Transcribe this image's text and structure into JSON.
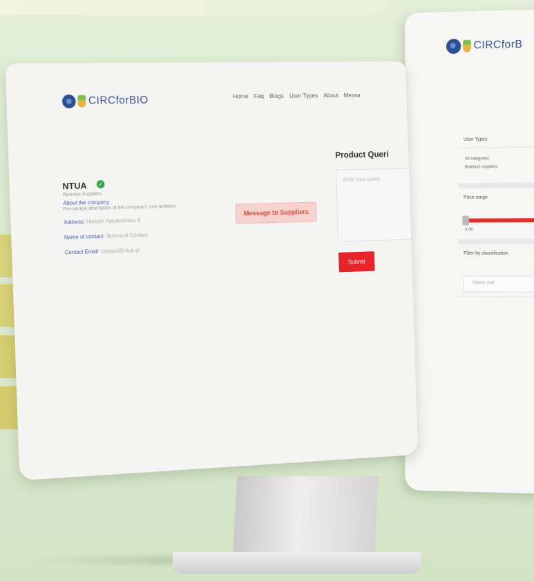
{
  "monitor1": {
    "logo_text": "CIRCforBIO",
    "nav": [
      "Home",
      "Faq",
      "Blogs",
      "User Types",
      "About",
      "Messa"
    ],
    "company": {
      "name": "NTUA",
      "type_label": "Biomass Suppliers",
      "about_label": "About the company",
      "about_text": "Pre-sample description of the company's core activities",
      "address_label": "Address:",
      "address_value": "Heroon Polytechniou 9",
      "contact_name_label": "Name of contact:",
      "contact_name_value": "Technical Contact",
      "contact_email_label": "Contact Email:",
      "contact_email_value": "contact@ntua.gr"
    },
    "message_button": "Message to Suppliers",
    "product_query": {
      "title": "Product Queri",
      "placeholder": "Write your questi",
      "submit": "Submit"
    }
  },
  "monitor2": {
    "logo_text": "CIRCforB",
    "filters": {
      "user_types_label": "User Types",
      "option_all": "All categories",
      "option_biomass": "Biomass suppliers",
      "price_range_label": "Price range",
      "price_min": "0.00",
      "filter_label": "Filter by classification",
      "select_placeholder": "Select one"
    }
  },
  "colors": {
    "brand_blue": "#2d4f93",
    "accent_red": "#e8242b",
    "verified_green": "#3ca24c",
    "swatches": [
      "#dbd47c",
      "#dad178",
      "#d7cd72",
      "#d6cb6e"
    ]
  }
}
